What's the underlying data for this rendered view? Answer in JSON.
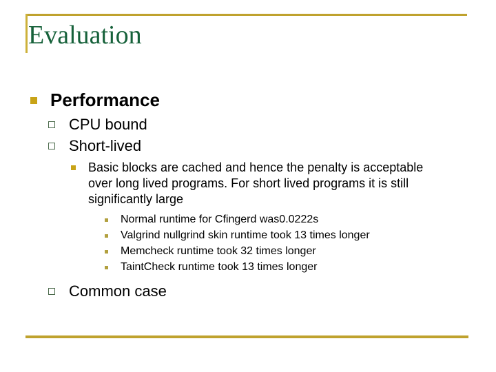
{
  "slide": {
    "title": "Evaluation",
    "colors": {
      "accent_gold": "#bfa22e",
      "bullet_gold": "#c8a317",
      "title_green": "#16613a",
      "bullet_green_outline": "#4c6b4c",
      "bullet_khaki": "#b2a03f",
      "text_black": "#000000",
      "background": "#ffffff"
    },
    "bullets": {
      "performance": "Performance",
      "cpu_bound": "CPU bound",
      "short_lived": "Short-lived",
      "basic_blocks": "Basic blocks are cached and hence the penalty is acceptable over long lived programs. For short lived programs it is still significantly large",
      "sub_items": [
        "Normal runtime for Cfingerd was0.0222s",
        "Valgrind nullgrind skin runtime took 13 times longer",
        "Memcheck runtime took 32 times longer",
        "TaintCheck runtime took 13 times longer"
      ],
      "common_case": "Common case"
    },
    "markers": {
      "level1": "filled-square-bullet",
      "level2": "hollow-square-bullet",
      "level3": "small-filled-square-bullet",
      "level4": "tiny-filled-square-bullet"
    }
  }
}
